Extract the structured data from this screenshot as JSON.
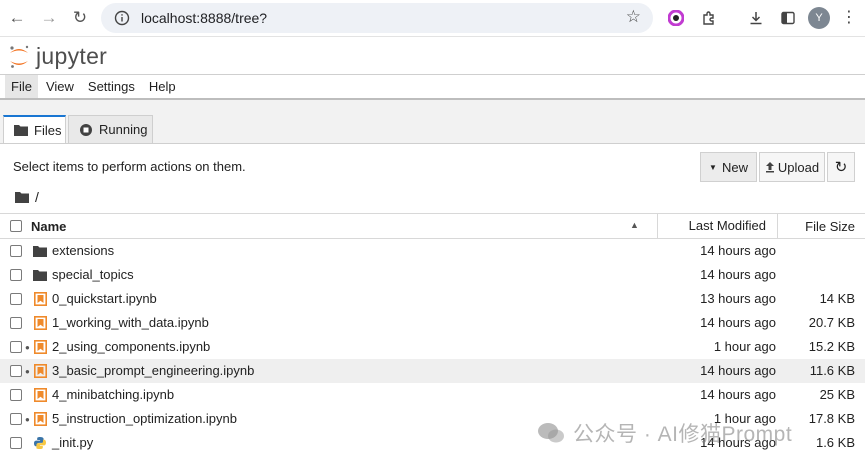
{
  "browser": {
    "url": "localhost:8888/tree?",
    "profile_initial": "Y"
  },
  "app": {
    "logo_text": "jupyter"
  },
  "menubar": {
    "items": [
      "File",
      "View",
      "Settings",
      "Help"
    ]
  },
  "tabs": {
    "files": "Files",
    "running": "Running"
  },
  "toolbar": {
    "hint": "Select items to perform actions on them.",
    "new_label": "New",
    "upload_label": "Upload"
  },
  "breadcrumb": {
    "path": "/"
  },
  "listing": {
    "headers": {
      "name": "Name",
      "last_modified": "Last Modified",
      "file_size": "File Size"
    },
    "rows": [
      {
        "name": "extensions",
        "type": "folder",
        "modified": "14 hours ago",
        "size": "",
        "running": false,
        "highlighted": false
      },
      {
        "name": "special_topics",
        "type": "folder",
        "modified": "14 hours ago",
        "size": "",
        "running": false,
        "highlighted": false
      },
      {
        "name": "0_quickstart.ipynb",
        "type": "notebook",
        "modified": "13 hours ago",
        "size": "14 KB",
        "running": false,
        "highlighted": false
      },
      {
        "name": "1_working_with_data.ipynb",
        "type": "notebook",
        "modified": "14 hours ago",
        "size": "20.7 KB",
        "running": false,
        "highlighted": false
      },
      {
        "name": "2_using_components.ipynb",
        "type": "notebook",
        "modified": "1 hour ago",
        "size": "15.2 KB",
        "running": true,
        "highlighted": false
      },
      {
        "name": "3_basic_prompt_engineering.ipynb",
        "type": "notebook",
        "modified": "14 hours ago",
        "size": "11.6 KB",
        "running": true,
        "highlighted": true
      },
      {
        "name": "4_minibatching.ipynb",
        "type": "notebook",
        "modified": "14 hours ago",
        "size": "25 KB",
        "running": false,
        "highlighted": false
      },
      {
        "name": "5_instruction_optimization.ipynb",
        "type": "notebook",
        "modified": "1 hour ago",
        "size": "17.8 KB",
        "running": true,
        "highlighted": false
      },
      {
        "name": "_init.py",
        "type": "python",
        "modified": "14 hours ago",
        "size": "1.6 KB",
        "running": false,
        "highlighted": false
      }
    ]
  },
  "watermark": {
    "text": "公众号 · AI修猫Prompt"
  },
  "colors": {
    "accent": "#1976d2",
    "notebook_icon": "#ef8a2b",
    "jupyter_orange": "#f37626"
  }
}
